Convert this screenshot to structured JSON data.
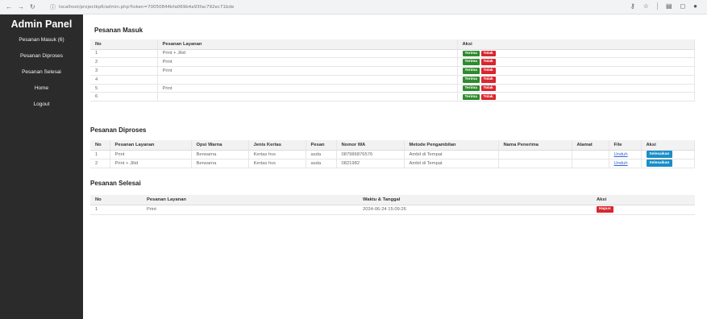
{
  "browser": {
    "url": "localhost/projectkp6/admin.php?token=70050844bfa069b4a93fac792ec71bde"
  },
  "sidebar": {
    "title": "Admin Panel",
    "items": [
      {
        "label": "Pesanan Masuk (6)"
      },
      {
        "label": "Pesanan Diproses"
      },
      {
        "label": "Pesanan Selesai"
      },
      {
        "label": "Home"
      },
      {
        "label": "Logout"
      }
    ]
  },
  "pesanan_masuk": {
    "title": "Pesanan Masuk",
    "headers": [
      "No",
      "Pesanan Layanan",
      "Aksi"
    ],
    "accept_label": "Terima",
    "reject_label": "Tolak",
    "rows": [
      {
        "no": "1",
        "layanan": "Print + Jilid"
      },
      {
        "no": "2",
        "layanan": "Print"
      },
      {
        "no": "3",
        "layanan": "Print"
      },
      {
        "no": "4",
        "layanan": ""
      },
      {
        "no": "5",
        "layanan": "Print"
      },
      {
        "no": "6",
        "layanan": ""
      }
    ]
  },
  "pesanan_diproses": {
    "title": "Pesanan Diproses",
    "headers": [
      "No",
      "Pesanan Layanan",
      "Opsi Warna",
      "Jenis Kertas",
      "Pesan",
      "Nomor WA",
      "Metode Pengambilan",
      "Nama Penerima",
      "Alamat",
      "File",
      "Aksi"
    ],
    "download_label": "Unduh",
    "finish_label": "Selesaikan",
    "rows": [
      {
        "no": "1",
        "layanan": "Print",
        "warna": "Berwarna",
        "kertas": "Kertas hvs",
        "pesan": "asda",
        "wa": "087986876576",
        "metode": "Ambil di Tempat",
        "penerima": "",
        "alamat": ""
      },
      {
        "no": "2",
        "layanan": "Print + Jilid",
        "warna": "Berwarna",
        "kertas": "Kertas hvs",
        "pesan": "asda",
        "wa": "0821982",
        "metode": "Ambil di Tempat",
        "penerima": "",
        "alamat": ""
      }
    ]
  },
  "pesanan_selesai": {
    "title": "Pesanan Selesai",
    "headers": [
      "No",
      "Pesanan Layanan",
      "Waktu & Tanggal",
      "Aksi"
    ],
    "delete_label": "Hapus",
    "rows": [
      {
        "no": "1",
        "layanan": "Print",
        "waktu": "2024-06-24 15:09:26"
      }
    ]
  },
  "colors": {
    "sidebar_bg": "#2b2b2b",
    "accept": "#2e8b2e",
    "reject": "#d9262e",
    "finish": "#1a8ec8"
  }
}
